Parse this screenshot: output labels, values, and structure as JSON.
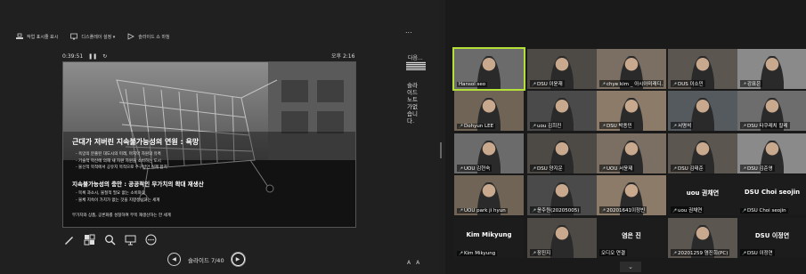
{
  "toolbar": {
    "show_taskbar": "작업 표시줄 표시",
    "display_settings": "디스플레이 설정 ▾",
    "end_show": "슬라이드 쇼 마침",
    "more": "..."
  },
  "timer": {
    "elapsed": "0:39:51",
    "clock": "오후 2:16"
  },
  "slide": {
    "title": "근대가 저버린 지속불가능성의 연원 : 욕망",
    "bullets1": [
      "- 욕망의 분출된 대도시의 미래, 마지막 자원의 유혹",
      "- 기술적 혁신에 의해 새 자원 자원을 소비하는 도시",
      "- 물신적 목적에서 공유지 목적으로 추구방안 실제 합치"
    ],
    "subtitle": "지속불가능성의 충만 : 공공적인 무가치의 확대 재생산",
    "bullets2": [
      "- 목록 과소시, 물질적 필요 없는 소비와의",
      "- 물체 지속이 가치가 없는 것을 지향생산하는 세계"
    ],
    "footer": "무가치와 상품, 공론화를 성찰하여 무목 재생산하는 한 세계"
  },
  "navigation": {
    "label": "슬라이드 7/40",
    "prev": "◀",
    "next": "▶"
  },
  "notes": {
    "next_label": "다음...",
    "text": "슬라이드노트가없습니다."
  },
  "font_controls": {
    "larger": "A",
    "smaller": "A"
  },
  "tools": [
    "pen",
    "slides-grid",
    "zoom",
    "screen",
    "more"
  ],
  "gallery": {
    "tiles": [
      {
        "name": "Hansol seo",
        "muted": false,
        "active": true,
        "kind": "video"
      },
      {
        "name": "DSU 이윤재",
        "muted": true,
        "kind": "video"
      },
      {
        "name": "chye kim _ 아시아미래디...",
        "muted": true,
        "kind": "video"
      },
      {
        "name": "DUS 이소민",
        "muted": true,
        "kind": "video"
      },
      {
        "name": "강표은",
        "muted": true,
        "kind": "video"
      },
      {
        "name": "Dohyun LEE",
        "muted": true,
        "kind": "video"
      },
      {
        "name": "uou 김희진",
        "muted": true,
        "kind": "video"
      },
      {
        "name": "DSU 박종민",
        "muted": true,
        "kind": "video"
      },
      {
        "name": "서명석",
        "muted": true,
        "kind": "video"
      },
      {
        "name": "DSU 타쿠레치 칼레",
        "muted": true,
        "kind": "video"
      },
      {
        "name": "UOU 김현숙",
        "muted": true,
        "kind": "video"
      },
      {
        "name": "DSU 양지운",
        "muted": true,
        "kind": "video"
      },
      {
        "name": "UOU 서윤제",
        "muted": true,
        "kind": "video"
      },
      {
        "name": "DSU 김태준",
        "muted": true,
        "kind": "video"
      },
      {
        "name": "DSU 김준영",
        "muted": true,
        "kind": "video"
      },
      {
        "name": "UOU park ji hyun",
        "muted": true,
        "kind": "video"
      },
      {
        "name": "윤주원(20205005)",
        "muted": true,
        "kind": "video"
      },
      {
        "name": "20201641이정빈",
        "muted": true,
        "kind": "video"
      },
      {
        "name": "uou 권채연",
        "muted": true,
        "kind": "text",
        "big": "uou 권채연"
      },
      {
        "name": "DSU Choi seojin",
        "muted": true,
        "kind": "text",
        "big": "DSU Choi seojin"
      },
      {
        "name": "Kim Mikyung",
        "muted": true,
        "kind": "text",
        "big": "Kim Mikyung"
      },
      {
        "name": "장진지",
        "muted": true,
        "kind": "video"
      },
      {
        "name": "오디오 연결",
        "muted": false,
        "kind": "text",
        "big": "염은 진"
      },
      {
        "name": "20201259 염진희(PC)",
        "muted": true,
        "kind": "video"
      },
      {
        "name": "DSU 이정연",
        "muted": true,
        "kind": "text",
        "big": "DSU 이정연"
      }
    ],
    "scroll_down": "⌄"
  },
  "colors": {
    "active_speaker": "#b5e03a",
    "muted_mic": "#e83030"
  }
}
